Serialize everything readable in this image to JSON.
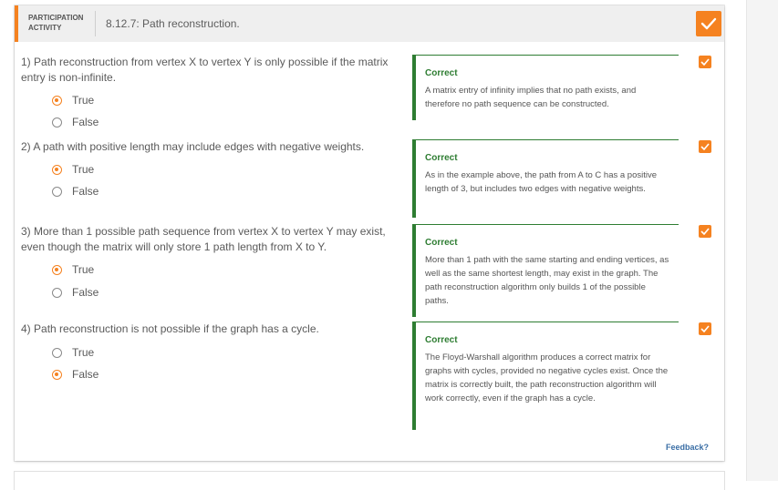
{
  "activity": {
    "label": "PARTICIPATION ACTIVITY",
    "title": "8.12.7: Path reconstruction."
  },
  "colors": {
    "accent": "#f58220",
    "correct": "#2e7d32",
    "link": "#3a6ea5"
  },
  "icons": {
    "completion": "check-icon",
    "question_status": "check-icon"
  },
  "questions": [
    {
      "number": "1)",
      "text": "Path reconstruction from vertex X to vertex Y is only possible if the matrix entry is non-infinite.",
      "options": [
        {
          "label": "True",
          "selected": true
        },
        {
          "label": "False",
          "selected": false
        }
      ],
      "feedback": {
        "title": "Correct",
        "text": "A matrix entry of infinity implies that no path exists, and therefore no path sequence can be constructed."
      }
    },
    {
      "number": "2)",
      "text": "A path with positive length may include edges with negative weights.",
      "options": [
        {
          "label": "True",
          "selected": true
        },
        {
          "label": "False",
          "selected": false
        }
      ],
      "feedback": {
        "title": "Correct",
        "text": "As in the example above, the path from A to C has a positive length of 3, but includes two edges with negative weights."
      }
    },
    {
      "number": "3)",
      "text": "More than 1 possible path sequence from vertex X to vertex Y may exist, even though the matrix will only store 1 path length from X to Y.",
      "options": [
        {
          "label": "True",
          "selected": true
        },
        {
          "label": "False",
          "selected": false
        }
      ],
      "feedback": {
        "title": "Correct",
        "text": "More than 1 path with the same starting and ending vertices, as well as the same shortest length, may exist in the graph. The path reconstruction algorithm only builds 1 of the possible paths."
      }
    },
    {
      "number": "4)",
      "text": "Path reconstruction is not possible if the graph has a cycle.",
      "options": [
        {
          "label": "True",
          "selected": false
        },
        {
          "label": "False",
          "selected": true
        }
      ],
      "feedback": {
        "title": "Correct",
        "text": "The Floyd-Warshall algorithm produces a correct matrix for graphs with cycles, provided no negative cycles exist. Once the matrix is correctly built, the path reconstruction algorithm will work correctly, even if the graph has a cycle."
      }
    }
  ],
  "footer": {
    "feedback_link": "Feedback?"
  }
}
